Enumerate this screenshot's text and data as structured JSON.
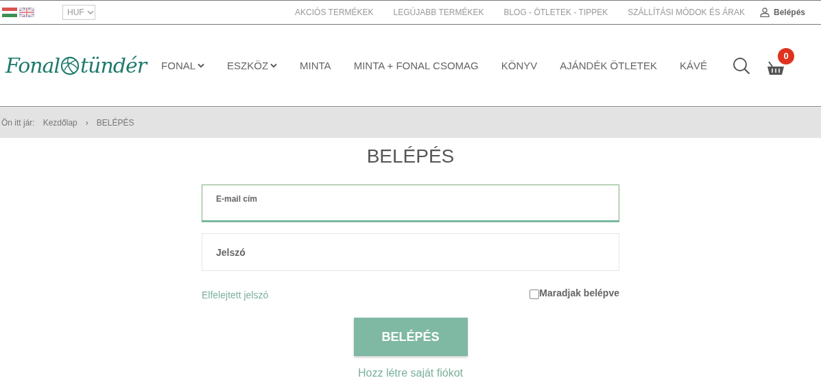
{
  "top_bar": {
    "currency": "HUF",
    "links": [
      "AKCIÓS TERMÉKEK",
      "LEGÚJABB TERMÉKEK",
      "BLOG - ÖTLETEK - TIPPEK",
      "SZÁLLÍTÁSI MÓDOK ÉS ÁRAK"
    ],
    "login": "Belépés"
  },
  "logo": {
    "left": "Fonal",
    "right": "tündér"
  },
  "nav": [
    {
      "label": "FONAL",
      "dropdown": true
    },
    {
      "label": "ESZKÖZ",
      "dropdown": true
    },
    {
      "label": "MINTA",
      "dropdown": false
    },
    {
      "label": "MINTA + FONAL CSOMAG",
      "dropdown": false
    },
    {
      "label": "KÖNYV",
      "dropdown": false
    },
    {
      "label": "AJÁNDÉK ÖTLETEK",
      "dropdown": false
    },
    {
      "label": "KÁVÉ",
      "dropdown": false
    }
  ],
  "cart_count": "0",
  "breadcrumb": {
    "prefix": "Ön itt jár:",
    "items": [
      "Kezdőlap",
      "BELÉPÉS"
    ],
    "separator": "›"
  },
  "form": {
    "title": "BELÉPÉS",
    "fields": [
      {
        "label": "E-mail cím",
        "focused": true
      },
      {
        "label": "Jelszó",
        "focused": false
      }
    ],
    "forgot": "Elfelejtett jelszó",
    "remember": {
      "label": "Maradjak belépve",
      "checked": false
    },
    "submit": "BELÉPÉS",
    "register": "Hozz létre saját fiókot"
  }
}
